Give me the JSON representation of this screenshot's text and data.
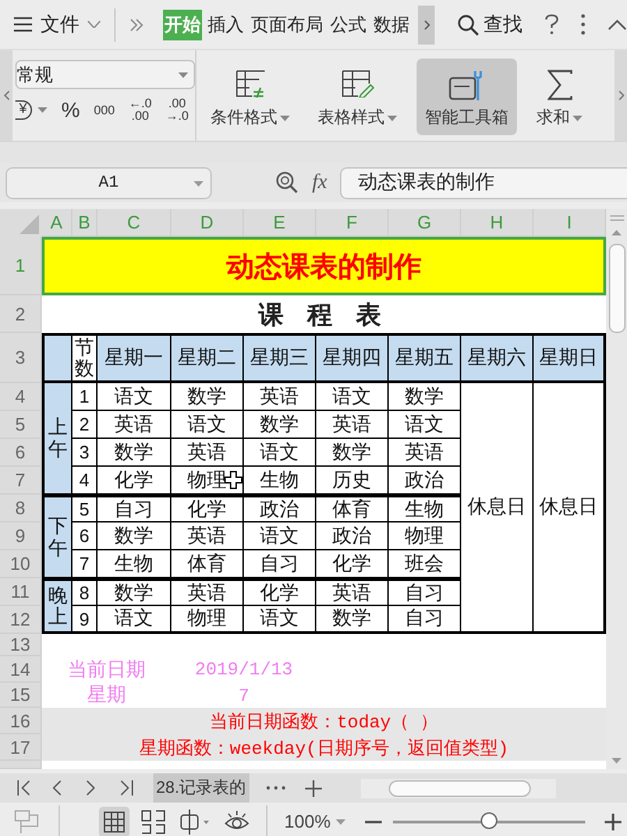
{
  "menu_bar": {
    "file_menu": "文件",
    "tabs": [
      {
        "label": "开始",
        "selected": true
      },
      {
        "label": "插入",
        "selected": false
      },
      {
        "label": "页面布局",
        "selected": false
      },
      {
        "label": "公式",
        "selected": false
      },
      {
        "label": "数据",
        "selected": false
      }
    ],
    "search": "查找"
  },
  "ribbon": {
    "number_format": "常规",
    "number_buttons": [
      {
        "kind": "currency",
        "text": "¥"
      },
      {
        "kind": "percent",
        "text": "%"
      },
      {
        "kind": "thousands",
        "text": "000"
      },
      {
        "kind": "decimal",
        "top": "←.0",
        "bottom": ".00"
      },
      {
        "kind": "decimal",
        "top": ".00",
        "bottom": "→.0"
      }
    ],
    "tools": [
      {
        "kind": "conditional",
        "label": "条件格式",
        "dropdown": true,
        "selected": false
      },
      {
        "kind": "table_style",
        "label": "表格样式",
        "dropdown": true,
        "selected": false
      },
      {
        "kind": "toolbox",
        "label": "智能工具箱",
        "dropdown": false,
        "selected": true
      },
      {
        "kind": "sum",
        "label": "求和",
        "dropdown": true,
        "selected": false
      }
    ]
  },
  "formula_bar": {
    "name_box": "A1",
    "fx": "fx",
    "formula": "动态课表的制作"
  },
  "sheet": {
    "columns": [
      {
        "label": "A",
        "selected": true
      },
      {
        "label": "B",
        "selected": true
      },
      {
        "label": "C",
        "selected": true
      },
      {
        "label": "D",
        "selected": true
      },
      {
        "label": "E",
        "selected": true
      },
      {
        "label": "F",
        "selected": true
      },
      {
        "label": "G",
        "selected": true
      },
      {
        "label": "H",
        "selected": true
      },
      {
        "label": "I",
        "selected": true
      }
    ],
    "rows": [
      {
        "label": "1",
        "selected": true
      },
      {
        "label": "2",
        "selected": false
      },
      {
        "label": "3",
        "selected": false
      },
      {
        "label": "4",
        "selected": false
      },
      {
        "label": "5",
        "selected": false
      },
      {
        "label": "6",
        "selected": false
      },
      {
        "label": "7",
        "selected": false
      },
      {
        "label": "8",
        "selected": false
      },
      {
        "label": "9",
        "selected": false
      },
      {
        "label": "10",
        "selected": false
      },
      {
        "label": "11",
        "selected": false
      },
      {
        "label": "12",
        "selected": false
      },
      {
        "label": "13",
        "selected": false
      },
      {
        "label": "14",
        "selected": false
      },
      {
        "label": "15",
        "selected": false
      },
      {
        "label": "16",
        "selected": false
      },
      {
        "label": "17",
        "selected": false
      }
    ],
    "title": "动态课表的制作",
    "subtitle": "课 程 表",
    "header": {
      "period_label": "节数",
      "days": [
        "星期一",
        "星期二",
        "星期三",
        "星期四",
        "星期五",
        "星期六",
        "星期日"
      ]
    },
    "sessions": [
      {
        "label": "上午",
        "periods": [
          {
            "number": "1",
            "classes": [
              "语文",
              "数学",
              "英语",
              "语文",
              "数学"
            ]
          },
          {
            "number": "2",
            "classes": [
              "英语",
              "语文",
              "数学",
              "英语",
              "语文"
            ]
          },
          {
            "number": "3",
            "classes": [
              "数学",
              "英语",
              "语文",
              "数学",
              "英语"
            ]
          },
          {
            "number": "4",
            "classes": [
              "化学",
              "物理",
              "生物",
              "历史",
              "政治"
            ]
          }
        ]
      },
      {
        "label": "下午",
        "periods": [
          {
            "number": "5",
            "classes": [
              "自习",
              "化学",
              "政治",
              "体育",
              "生物"
            ]
          },
          {
            "number": "6",
            "classes": [
              "数学",
              "英语",
              "语文",
              "政治",
              "物理"
            ]
          },
          {
            "number": "7",
            "classes": [
              "生物",
              "体育",
              "自习",
              "化学",
              "班会"
            ]
          }
        ]
      },
      {
        "label": "晚上",
        "periods": [
          {
            "number": "8",
            "classes": [
              "数学",
              "英语",
              "化学",
              "英语",
              "自习"
            ]
          },
          {
            "number": "9",
            "classes": [
              "语文",
              "物理",
              "语文",
              "数学",
              "自习"
            ]
          }
        ]
      }
    ],
    "rest_days": [
      "休息日",
      "休息日"
    ],
    "info": [
      {
        "label": "当前日期",
        "value": "2019/1/13"
      },
      {
        "label": "星期",
        "value": "7"
      }
    ],
    "notes": [
      "当前日期函数：today（ ）",
      "星期函数：weekday(日期序号，返回值类型)"
    ]
  },
  "sheet_tabs": [
    {
      "label": "28.记录表的",
      "selected": true
    }
  ],
  "status_bar": {
    "zoom": "100%",
    "zoom_slider": {
      "level": 0.5
    }
  }
}
